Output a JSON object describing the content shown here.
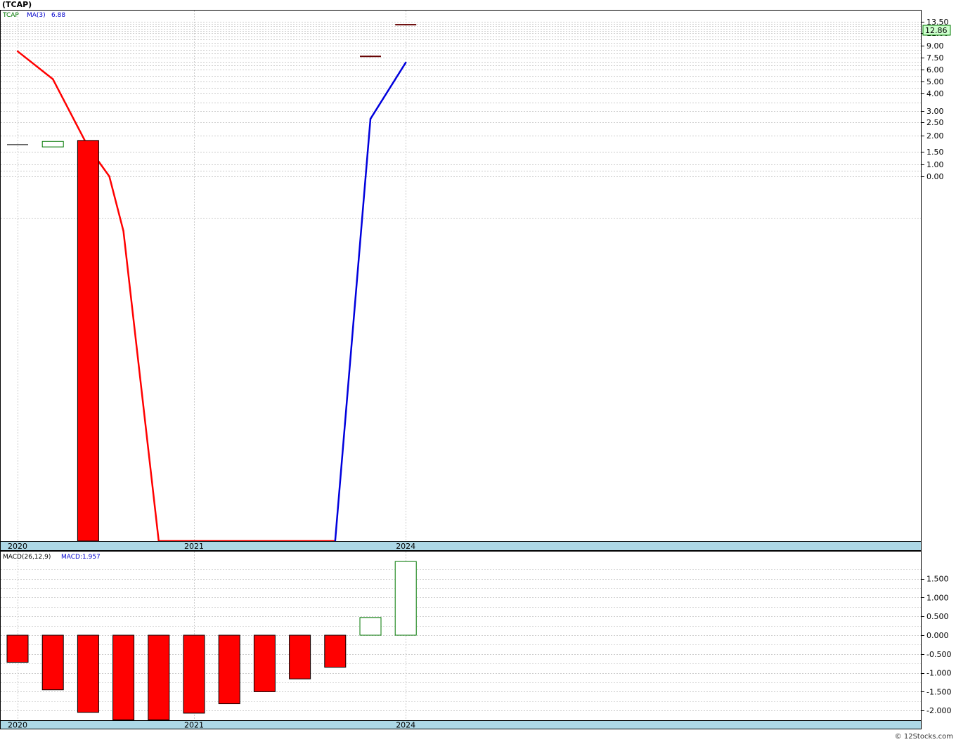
{
  "title": "(TCAP)",
  "credit": "© 12Stocks.com",
  "chart_data": [
    {
      "type": "line",
      "legend": {
        "symbol": "TCAP",
        "ma_label": "MA(3)",
        "ma_value": "6.88"
      },
      "price_badge": "12.86",
      "y_tick_labels": [
        "13.50",
        "11.00",
        "9.00",
        "7.50",
        "6.00",
        "5.00",
        "4.00",
        "3.00",
        "2.50",
        "2.00",
        "1.50",
        "1.00",
        "0.00"
      ],
      "x_tick_labels": [
        {
          "label": "2020",
          "index": 0
        },
        {
          "label": "2021",
          "index": 5
        },
        {
          "label": "2024",
          "index": 11
        }
      ],
      "x_index_range": [
        -0.5,
        25.5
      ],
      "candles": [
        {
          "index": 0,
          "open": 1.72,
          "close": 1.72,
          "high": 1.72,
          "low": 1.72
        },
        {
          "index": 1,
          "open": 1.65,
          "close": 1.82,
          "high": 1.82,
          "low": 1.65
        },
        {
          "index": 2,
          "open": 1.85,
          "close": -3.0,
          "high": 1.85,
          "low": -3.0
        },
        {
          "index": 10,
          "open": 7.65,
          "close": 7.65,
          "high": 7.75,
          "low": 7.55
        },
        {
          "index": 11,
          "open": 12.86,
          "close": 12.86,
          "high": 13.0,
          "low": 12.7
        }
      ],
      "series": [
        {
          "name": "MA(3)",
          "values": [
            {
              "index": 0,
              "value": 8.3
            },
            {
              "index": 1,
              "value": 5.2
            },
            {
              "index": 2,
              "value": 1.65
            },
            {
              "index": 2.6,
              "value": 0.0
            },
            {
              "index": 3,
              "value": -0.45
            },
            {
              "index": 4,
              "value": -3.0
            },
            {
              "index": 9,
              "value": -3.0
            },
            {
              "index": 10,
              "value": 2.65
            },
            {
              "index": 11,
              "value": 6.88
            }
          ]
        }
      ],
      "line_colors": {
        "falling": "#ff0000",
        "rising": "#0000dd"
      }
    },
    {
      "type": "bar",
      "legend": {
        "name": "MACD(26,12,9)",
        "value_label": "MACD:1.957"
      },
      "y_tick_labels": [
        "1.500",
        "1.000",
        "0.500",
        "0.000",
        "-0.500",
        "-1.000",
        "-1.500",
        "-2.000"
      ],
      "ylim": [
        -2.25,
        2.0
      ],
      "x_tick_labels": [
        {
          "label": "2020",
          "index": 0
        },
        {
          "label": "2021",
          "index": 5
        },
        {
          "label": "2024",
          "index": 11
        }
      ],
      "values": [
        -0.72,
        -1.45,
        -2.05,
        -2.25,
        -2.25,
        -2.07,
        -1.82,
        -1.5,
        -1.16,
        -0.85,
        0.47,
        1.957
      ],
      "colors": {
        "negative": "#ff0000",
        "positive_outline": "#007700"
      }
    }
  ]
}
